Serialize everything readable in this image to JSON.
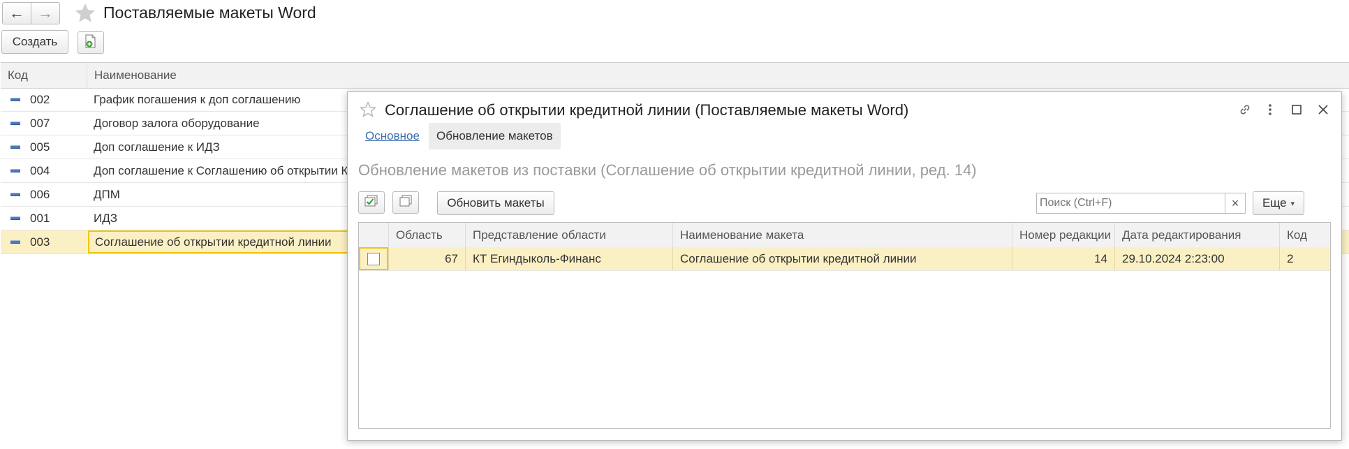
{
  "window": {
    "title": "Поставляемые макеты Word",
    "nav_back": "←",
    "nav_forward": "→",
    "create_label": "Создать"
  },
  "list": {
    "columns": [
      "Код",
      "Наименование"
    ],
    "rows": [
      {
        "code": "002",
        "name": "График погашения к доп соглашению"
      },
      {
        "code": "007",
        "name": "Договор залога оборудование"
      },
      {
        "code": "005",
        "name": "Доп соглашение к ИДЗ"
      },
      {
        "code": "004",
        "name": "Доп соглашение к Соглашению об открытии Кl"
      },
      {
        "code": "006",
        "name": "ДПМ"
      },
      {
        "code": "001",
        "name": "ИДЗ"
      },
      {
        "code": "003",
        "name": "Соглашение об открытии кредитной линии"
      }
    ],
    "selected_row": 6
  },
  "dialog": {
    "title": "Соглашение об открытии кредитной линии (Поставляемые макеты Word)",
    "tabs": [
      {
        "label": "Основное",
        "active": false
      },
      {
        "label": "Обновление макетов",
        "active": true
      }
    ],
    "section_title": "Обновление макетов из поставки (Соглашение об открытии кредитной линии, ред. 14)",
    "update_button": "Обновить макеты",
    "search": {
      "placeholder": "Поиск (Ctrl+F)",
      "value": "",
      "clear": "×"
    },
    "more_button": "Еще",
    "more_arrow": "▾",
    "table": {
      "columns": [
        "Область",
        "Представление области",
        "Наименование макета",
        "Номер редакции",
        "Дата редактирования",
        "Код"
      ],
      "rows": [
        {
          "checked": false,
          "area": "67",
          "area_name": "КТ Егиндыколь-Финанс",
          "template_name": "Соглашение об открытии кредитной линии",
          "revision": "14",
          "edited": "29.10.2024 2:23:00",
          "code": "2"
        }
      ]
    }
  },
  "colors": {
    "selection": "#fbf0c4",
    "selection_border": "#f2c40c",
    "link": "#3b6fb0"
  }
}
